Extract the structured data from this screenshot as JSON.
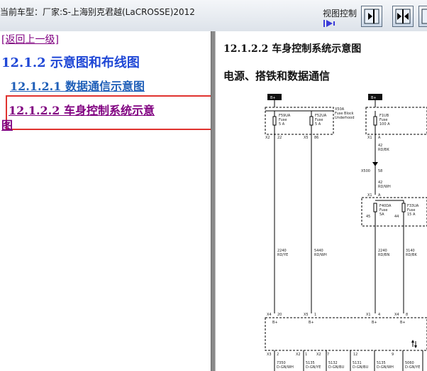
{
  "header": {
    "car_model": "当前车型：厂家:S-上海别克君越(LaCROSSE)2012",
    "view_control_label": "视图控制"
  },
  "nav": {
    "back_link": "[返回上一级]",
    "section": "12.1.2 示意图和布线图",
    "items": [
      {
        "label": "12.1.2.1 数据通信示意图"
      },
      {
        "label_line1": "12.1.2.2 车身控制系统示意",
        "label_line2": "图"
      }
    ]
  },
  "content": {
    "title": "12.1.2.2 车身控制系统示意图",
    "subtitle": "电源、搭铁和数据通信",
    "diagram": {
      "bplus1": "B+",
      "bplus2": "B+",
      "x50a": "X50A",
      "fuse_block": "Fuse Block",
      "underhood": "Underhood",
      "f59ua": "F59UA",
      "f59ua_fuse": "Fuse",
      "f59ua_amp": "5 A",
      "f52ua": "F52UA",
      "f52ua_fuse": "Fuse",
      "f52ua_amp": "5 A",
      "f1ub": "F1UB",
      "f1ub_fuse": "Fuse",
      "f1ub_amp": "100 A",
      "x2_pin22": "22",
      "x5_pin86": "86",
      "x1a": "A",
      "w42a": "42",
      "w42a_color": "RD/BK",
      "x500": "X500",
      "x500_pin": "58",
      "w42b": "42",
      "w42b_color": "RD/WH",
      "x1a2": "A",
      "f40da": "F40DA",
      "f40da_fuse": "Fuse",
      "f40da_amp": "5A",
      "f33ua": "F33UA",
      "f33ua_fuse": "Fuse",
      "f33ua_amp": "15 A",
      "pin45": "45",
      "pin44": "44",
      "w2240a": "2240",
      "w2240a_color": "RD/YE",
      "w5440": "5440",
      "w5440_color": "RD/WH",
      "w2240b": "2240",
      "w2240b_color": "RD/BN",
      "w3140": "3140",
      "w3140_color": "RD/BK",
      "k_x4": "X4",
      "k_x4_pin": "20",
      "k_x5": "X5",
      "k_x5_pin": "1",
      "k_x1": "X1",
      "k_x1_pin": "4",
      "k_x4b": "X4",
      "k_x4b_pin": "8",
      "kb1": "B+",
      "kb2": "B+",
      "kb3": "B+",
      "kb4": "B+",
      "b_x3": "X3",
      "b_pin2": "2",
      "b_x2": "X2",
      "b_pin1": "1",
      "b_x2b": "X2",
      "b_pin7": "7",
      "b_pin12": "12",
      "b_pin9": "9",
      "w7350": "7350",
      "w7350_color": "D-GN/WH",
      "w5135a": "5135",
      "w5135a_color": "D-GN/YE",
      "w5132": "5132",
      "w5132_color": "D-GN/BU",
      "w5131": "5131",
      "w5131_color": "D-GN/BU",
      "w5135b": "5135",
      "w5135b_color": "D-GN/WH",
      "w5060": "5060",
      "w5060_color": "D-GN/YE"
    }
  }
}
